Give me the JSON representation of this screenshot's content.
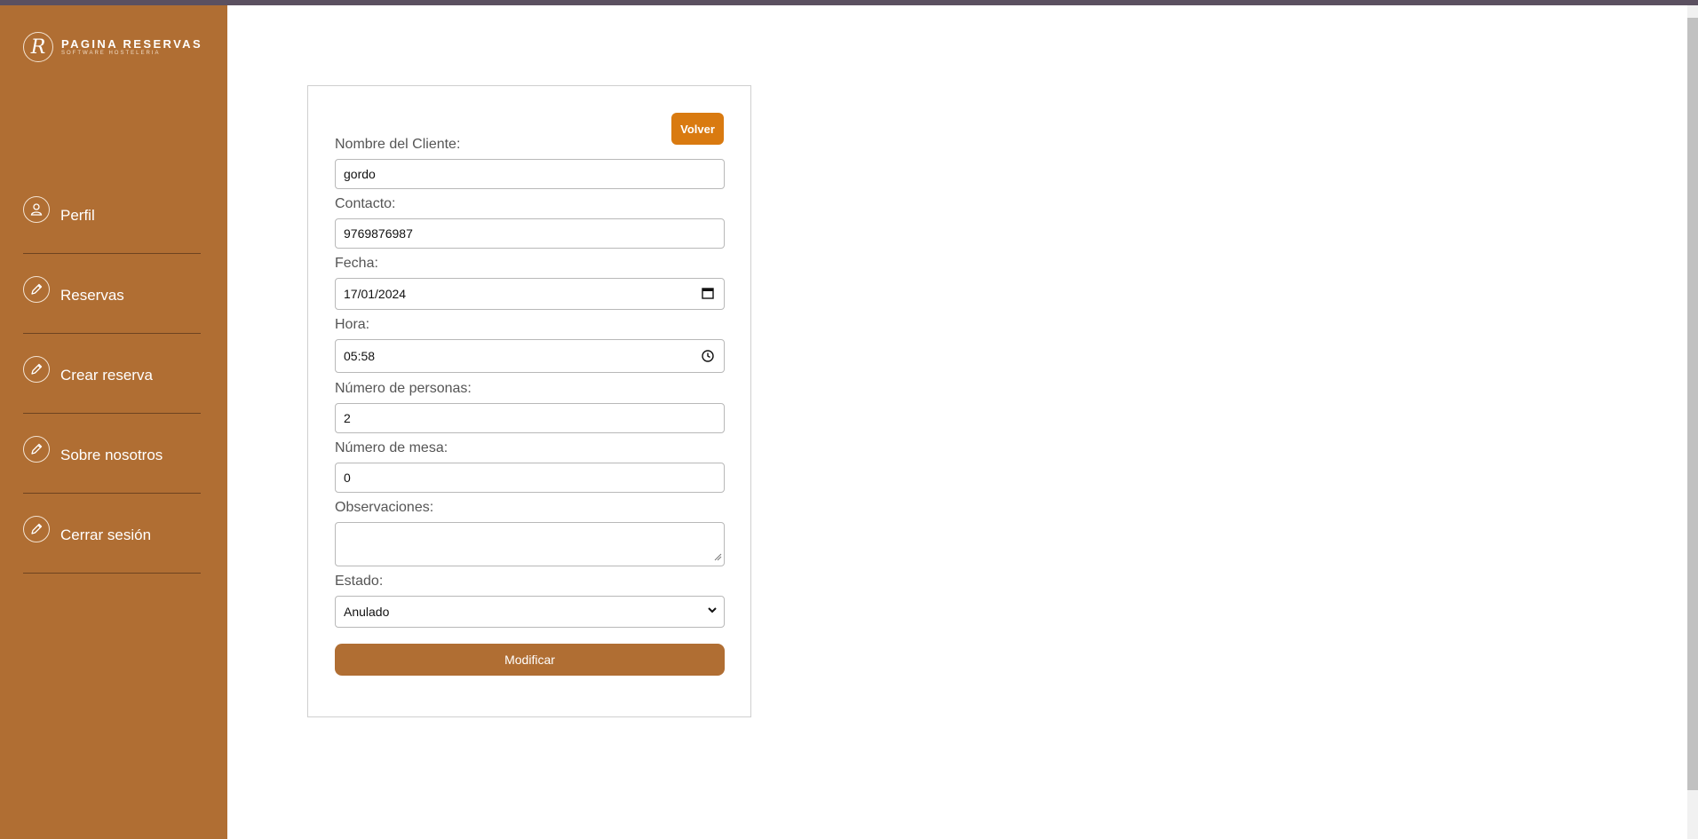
{
  "brand": {
    "name": "PAGINA RESERVAS",
    "subtitle": "SOFTWARE HOSTELERIA",
    "monogram": "R"
  },
  "sidebar": {
    "items": [
      {
        "label": "Perfil",
        "icon": "user-icon"
      },
      {
        "label": "Reservas",
        "icon": "pencil-icon"
      },
      {
        "label": "Crear reserva",
        "icon": "pencil-icon"
      },
      {
        "label": "Sobre nosotros",
        "icon": "pencil-icon"
      },
      {
        "label": "Cerrar sesión",
        "icon": "pencil-icon"
      }
    ]
  },
  "form": {
    "back_label": "Volver",
    "cliente": {
      "label": "Nombre del Cliente:",
      "value": "gordo"
    },
    "contacto": {
      "label": "Contacto:",
      "value": "9769876987"
    },
    "fecha": {
      "label": "Fecha:",
      "value": "17/01/2024"
    },
    "hora": {
      "label": "Hora:",
      "value": "05:58"
    },
    "personas": {
      "label": "Número de personas:",
      "value": "2"
    },
    "mesa": {
      "label": "Número de mesa:",
      "value": "0"
    },
    "observaciones": {
      "label": "Observaciones:",
      "value": ""
    },
    "estado": {
      "label": "Estado:",
      "value": "Anulado"
    },
    "submit_label": "Modificar"
  },
  "colors": {
    "sidebar": "#b06e33",
    "accent": "#d97a10",
    "submit": "#b06e33"
  }
}
